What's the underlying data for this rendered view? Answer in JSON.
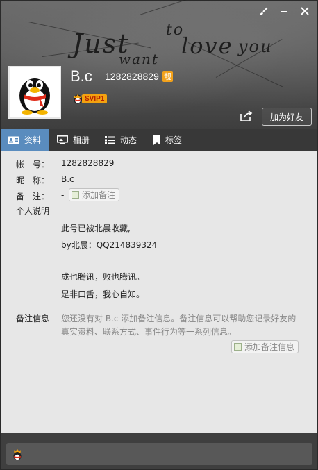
{
  "header": {
    "banner_words": [
      "Just",
      "to",
      "love",
      "you",
      "want"
    ],
    "nickname": "B.c",
    "qq_number": "1282828829",
    "pretty_badge": "靓",
    "vip_label": "SVIP1",
    "add_friend_label": "加为好友"
  },
  "window_controls": {
    "skin_icon": "brush-icon",
    "minimize_icon": "minimize-icon",
    "close_icon": "close-icon"
  },
  "tabs": [
    {
      "label": "资料",
      "icon": "profile-card-icon",
      "active": true
    },
    {
      "label": "相册",
      "icon": "photo-icon",
      "active": false
    },
    {
      "label": "动态",
      "icon": "list-icon",
      "active": false
    },
    {
      "label": "标签",
      "icon": "bookmark-icon",
      "active": false
    }
  ],
  "profile": {
    "account_label": "帐　号：",
    "account_value": "1282828829",
    "nickname_label": "昵　称：",
    "nickname_value": "B.c",
    "remark_label": "备　注：",
    "remark_value": "-",
    "add_remark_button": "添加备注",
    "signature_label": "个人说明",
    "signature_lines": [
      "此号已被北晨收藏,",
      "by北晨：QQ214839324",
      "成也腾讯，败也腾讯。",
      "是非口舌，我心自知。"
    ],
    "note_label": "备注信息",
    "note_text_line1": "您还没有对 B.c 添加备注信息。备注信息可以帮助您记录好友的",
    "note_text_line2": "真实资料、联系方式、事件行为等一系列信息。",
    "add_note_button": "添加备注信息"
  },
  "colors": {
    "tab_active": "#5a8cbe",
    "content_bg": "#e7e7e7",
    "vip_gold": "#f3a20f"
  }
}
